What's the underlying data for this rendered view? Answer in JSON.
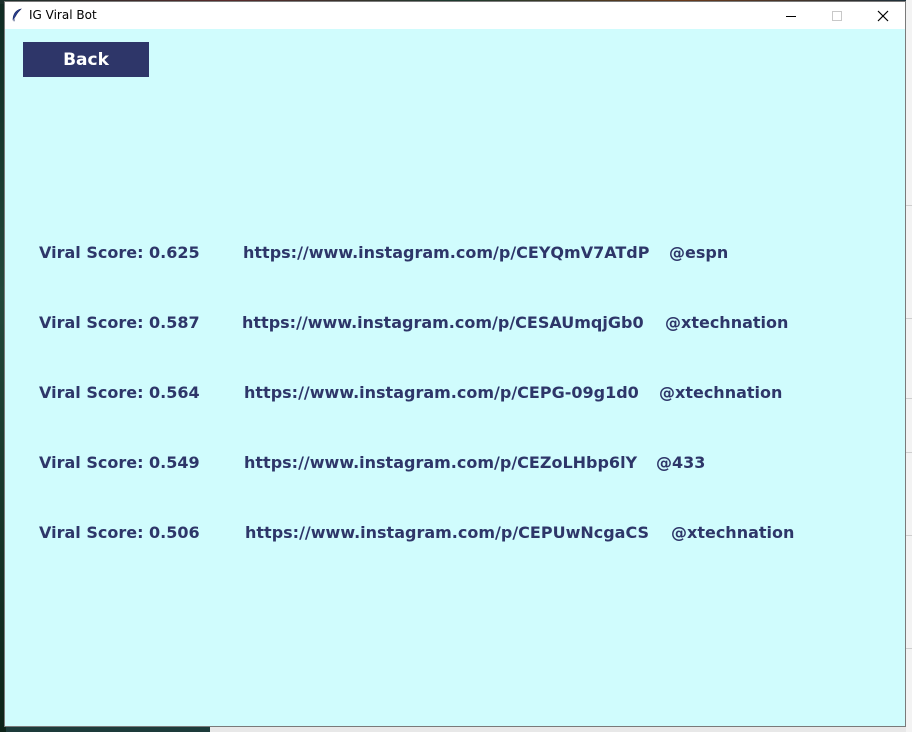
{
  "window": {
    "title": "IG Viral Bot",
    "icon": "feather-icon",
    "controls": [
      "minimize-icon",
      "maximize-icon",
      "close-icon"
    ]
  },
  "back_button": {
    "label": "Back"
  },
  "results": [
    {
      "score": "Viral Score: 0.625",
      "url": "https://www.instagram.com/p/CEYQmV7ATdP",
      "handle": "@espn"
    },
    {
      "score": "Viral Score: 0.587",
      "url": "https://www.instagram.com/p/CESAUmqjGb0",
      "handle": "@xtechnation"
    },
    {
      "score": "Viral Score: 0.564",
      "url": "https://www.instagram.com/p/CEPG-09g1d0",
      "handle": "@xtechnation"
    },
    {
      "score": "Viral Score: 0.549",
      "url": "https://www.instagram.com/p/CEZoLHbp6lY",
      "handle": "@433"
    },
    {
      "score": "Viral Score: 0.506",
      "url": "https://www.instagram.com/p/CEPUwNcgaCS",
      "handle": "@xtechnation"
    }
  ],
  "colors": {
    "content_background": "#d0fcfd",
    "accent": "#2e3669",
    "button_text": "#ffffff"
  }
}
